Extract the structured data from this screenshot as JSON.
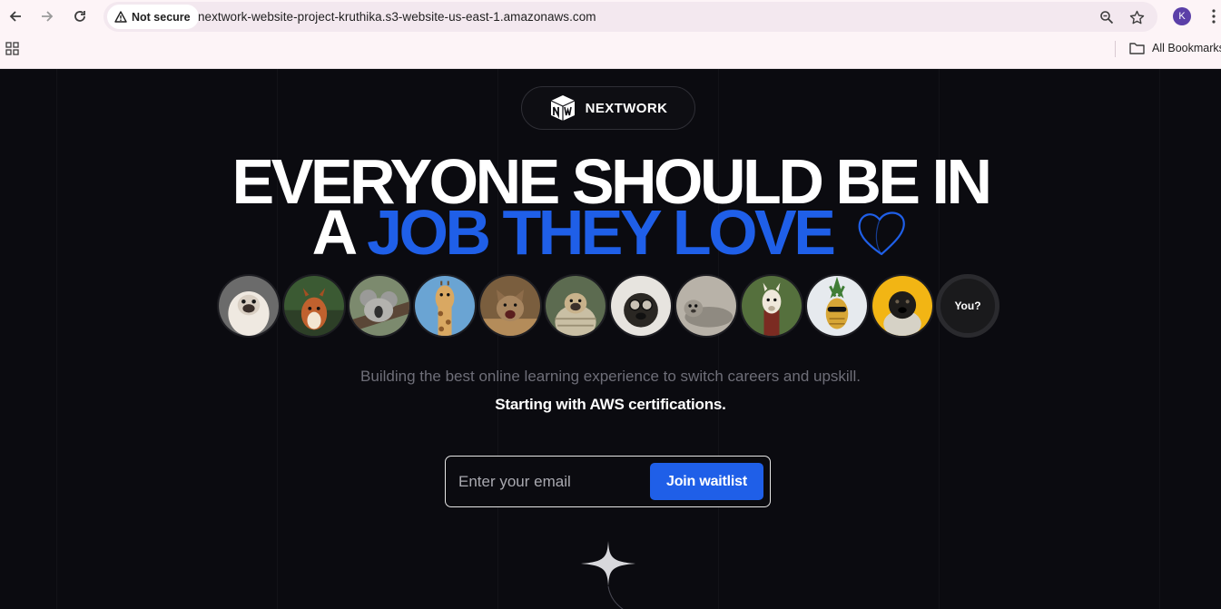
{
  "browser": {
    "security_label": "Not secure",
    "url": "nextwork-website-project-kruthika.s3-website-us-east-1.amazonaws.com",
    "profile_initial": "K",
    "bookmarks_label": "All Bookmarks",
    "icons": [
      "back-icon",
      "forward-icon",
      "reload-icon",
      "warning-icon",
      "zoom-icon",
      "star-icon",
      "kebab-menu-icon",
      "apps-grid-icon",
      "folder-icon"
    ]
  },
  "page": {
    "logo_text": "NEXTWORK",
    "headline": {
      "line1": "EVERYONE SHOULD BE IN",
      "line2_prefix": "A",
      "line2_highlight": "JOB THEY LOVE"
    },
    "avatars": [
      "pug-avatar",
      "squirrel-avatar",
      "koala-avatar",
      "giraffe-avatar",
      "cat-avatar",
      "pug-blanket-avatar",
      "pug-goggles-avatar",
      "seal-avatar",
      "llama-avatar",
      "pineapple-avatar",
      "pug-yellow-avatar"
    ],
    "you_label": "You?",
    "subtitle": "Building the best online learning experience to switch careers and upskill.",
    "subtitle_bold": "Starting with AWS certifications.",
    "email_placeholder": "Enter your email",
    "join_button": "Join waitlist"
  },
  "colors": {
    "accent": "#1f5fe8",
    "background": "#0b0b10",
    "chrome": "#fdf4f7"
  }
}
